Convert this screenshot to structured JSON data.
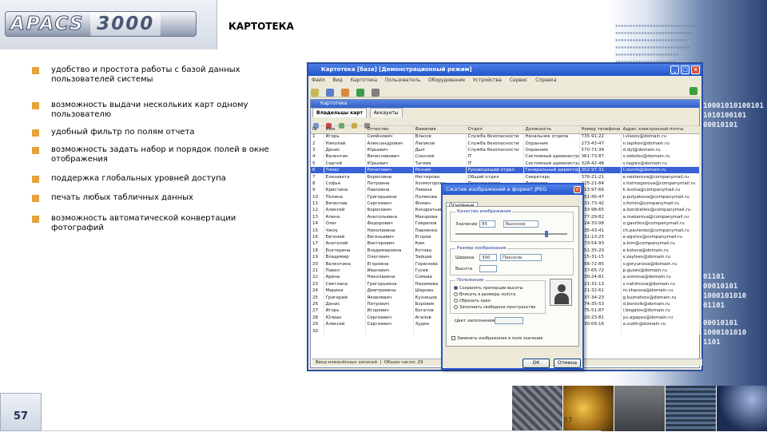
{
  "header": {
    "logo_text": "APACS",
    "logo_num": "3000",
    "title": "КАРТОТЕКА"
  },
  "bullets": [
    "удобство и простота работы с базой данных пользователей системы",
    "возможность выдачи нескольких карт одному пользователю",
    "удобный фильтр по полям отчета",
    "возможность задать набор и порядок полей в окне отображения",
    "поддержка глобальных уровней доступа",
    "печать любых табличных данных",
    "возможность автоматической конвертации фотографий"
  ],
  "binary_lines": [
    "10001010100101",
    "1010100101",
    "00010101",
    "01101",
    "00010101",
    "1000101010",
    "01101",
    "00010101",
    "1000101010",
    "1101"
  ],
  "app": {
    "title": "Картотека [база] [Демонстрационный режим]",
    "menu": [
      "Файл",
      "Вид",
      "Картотека",
      "Пользователь",
      "Оборудование",
      "Устройства",
      "Сервис",
      "Справка"
    ],
    "inner_title": "Картотека",
    "tabs": [
      "Владельцы карт",
      "Аккаунты"
    ],
    "columns": [
      "№",
      "Имя",
      "Отчество",
      "Фамилия",
      "Отдел",
      "Должность",
      "Номер телефона",
      "Адрес электронной почты"
    ],
    "rows": [
      [
        "1",
        "Игорь",
        "Семёнович",
        "Власов",
        "Служба безопасности",
        "Начальник отдела",
        "735-91-22",
        "i.vlasov@domain.ru"
      ],
      [
        "2",
        "Николай",
        "Александрович",
        "Лапиков",
        "Служба безопасности",
        "Охранник",
        "273-43-47",
        "n.lapikov@domain.ru"
      ],
      [
        "3",
        "Денис",
        "Юрьевич",
        "Дыл",
        "Служба безопасности",
        "Охранник",
        "570-71-39",
        "d.dyl@domain.ru"
      ],
      [
        "4",
        "Валентин",
        "Вячеславович",
        "Соколов",
        "IT",
        "Системный администратор",
        "361-73-87",
        "v.sokolov@domain.ru"
      ],
      [
        "5",
        "Сергей",
        "Юрьевич",
        "Тагиев",
        "IT",
        "Системный администратор",
        "328-42-48",
        "s.tagiev@domain.ru"
      ],
      [
        "6",
        "Томас",
        "Ринатович",
        "Резник",
        "Руководящий отдел",
        "Генеральный директор",
        "302-97-31",
        "t.reznik@domain.ru"
      ],
      [
        "7",
        "Елизавета",
        "Борисовна",
        "Нестерова",
        "Общий отдел",
        "Секретарь",
        "376-21-21",
        "e.nesterova@companymail.ru"
      ],
      [
        "8",
        "Софья",
        "Петровна",
        "Холмогорова",
        "Производство",
        "Директор",
        "225-21-84",
        "s.holmogorova@companymail.ru"
      ],
      [
        "9",
        "Кристина",
        "Павловна",
        "Левина",
        "Общий отдел",
        "Бухгалтер",
        "713-97-66",
        "k.levina@companymail.ru"
      ],
      [
        "10",
        "Полина",
        "Григорьевна",
        "Полякова",
        "",
        "",
        "351-45-47",
        "p.polyakova@companymail.ru"
      ],
      [
        "11",
        "Вячеслав",
        "Сергеевич",
        "Фомин",
        "",
        "",
        "231-73-42",
        "v.fomin@companymail.ru"
      ],
      [
        "12",
        "Алексей",
        "Борисович",
        "Кондратьев",
        "",
        "",
        "133-98-65",
        "a.kondratiev@companymail.ru"
      ],
      [
        "13",
        "Алена",
        "Анатольевна",
        "Макарова",
        "",
        "",
        "377-29-82",
        "a.makarova@companymail.ru"
      ],
      [
        "14",
        "Олег",
        "Федорович",
        "Гаврилов",
        "",
        "",
        "324-33-98",
        "o.gavrilov@companymail.ru"
      ],
      [
        "15",
        "Чжоу",
        "Николаевна",
        "Павленко",
        "",
        "",
        "735-43-41",
        "ch.pavlenko@companymail.ru"
      ],
      [
        "16",
        "Евгений",
        "Евгеньевич",
        "Егоров",
        "",
        "",
        "331-13-25",
        "e.egorov@companymail.ru"
      ],
      [
        "17",
        "Анатолий",
        "Викторович",
        "Ким",
        "",
        "",
        "273-54-93",
        "a.kim@companymail.ru"
      ],
      [
        "18",
        "Екатерина",
        "Владимировна",
        "Котова",
        "",
        "",
        "351-35-20",
        "e.kotova@domain.ru"
      ],
      [
        "19",
        "Владимир",
        "Олегович",
        "Зайцев",
        "",
        "",
        "215-31-15",
        "v.zaytsev@domain.ru"
      ],
      [
        "20",
        "Валентина",
        "Егоровна",
        "Горюнова",
        "",
        "",
        "256-72-85",
        "v.goryunova@domain.ru"
      ],
      [
        "21",
        "Павел",
        "Иванович",
        "Гусев",
        "",
        "",
        "237-65-72",
        "p.gusev@domain.ru"
      ],
      [
        "22",
        "Арина",
        "Николаевна",
        "Сомова",
        "",
        "",
        "730-24-81",
        "a.somova@domain.ru"
      ],
      [
        "23",
        "Светлана",
        "Григорьевна",
        "Нахимова",
        "",
        "",
        "721-31-13",
        "s.nahimova@domain.ru"
      ],
      [
        "24",
        "Марина",
        "Дмитриевна",
        "Шарова",
        "",
        "",
        "721-32-61",
        "m.sharova@domain.ru"
      ],
      [
        "25",
        "Григорий",
        "Яковлевич",
        "Кузнецов",
        "",
        "",
        "337-34-23",
        "g.kuznetsov@domain.ru"
      ],
      [
        "26",
        "Денис",
        "Петрович",
        "Боровик",
        "",
        "",
        "374-35-53",
        "d.borovik@domain.ru"
      ],
      [
        "27",
        "Игорь",
        "Игоревич",
        "Богатов",
        "",
        "",
        "375-51-87",
        "i.bogatov@domain.ru"
      ],
      [
        "28",
        "Юлиан",
        "Сергеевич",
        "Агапов",
        "",
        "",
        "320-23-81",
        "yu.agapov@domain.ru"
      ],
      [
        "29",
        "Алексей",
        "Сергеевич",
        "Зудин",
        "",
        "",
        "430-09-16",
        "a.zudin@domain.ru"
      ],
      [
        "30",
        "",
        "",
        "",
        "",
        "",
        "",
        ""
      ]
    ],
    "selected_row": 5,
    "status": [
      "Ввод изменённых записей",
      "Общее число: 29"
    ]
  },
  "dialog": {
    "title": "Сжатие изображений в формат JPEG",
    "tab": "Основные",
    "quality_group": "Качество изображения",
    "quality_label": "Значение",
    "quality_value": "85",
    "quality_level": "Высокое",
    "size_group": "Размер изображения",
    "width_label": "Ширина",
    "width_value": "300",
    "width_unit": "Пиксели",
    "height_label": "Высота",
    "height_value": "",
    "crop_group": "Положение",
    "radios": [
      "Сохранять пропорции высоты",
      "Вписать в размеры холста",
      "Обрезать края",
      "Заполнить свободное пространство"
    ],
    "color_label": "Цвет заполнения",
    "checkbox": "Заменить изображение в поле значение",
    "ok": "ОК",
    "cancel": "Отмена"
  },
  "footer": {
    "page": "57",
    "page_faint": "57"
  }
}
